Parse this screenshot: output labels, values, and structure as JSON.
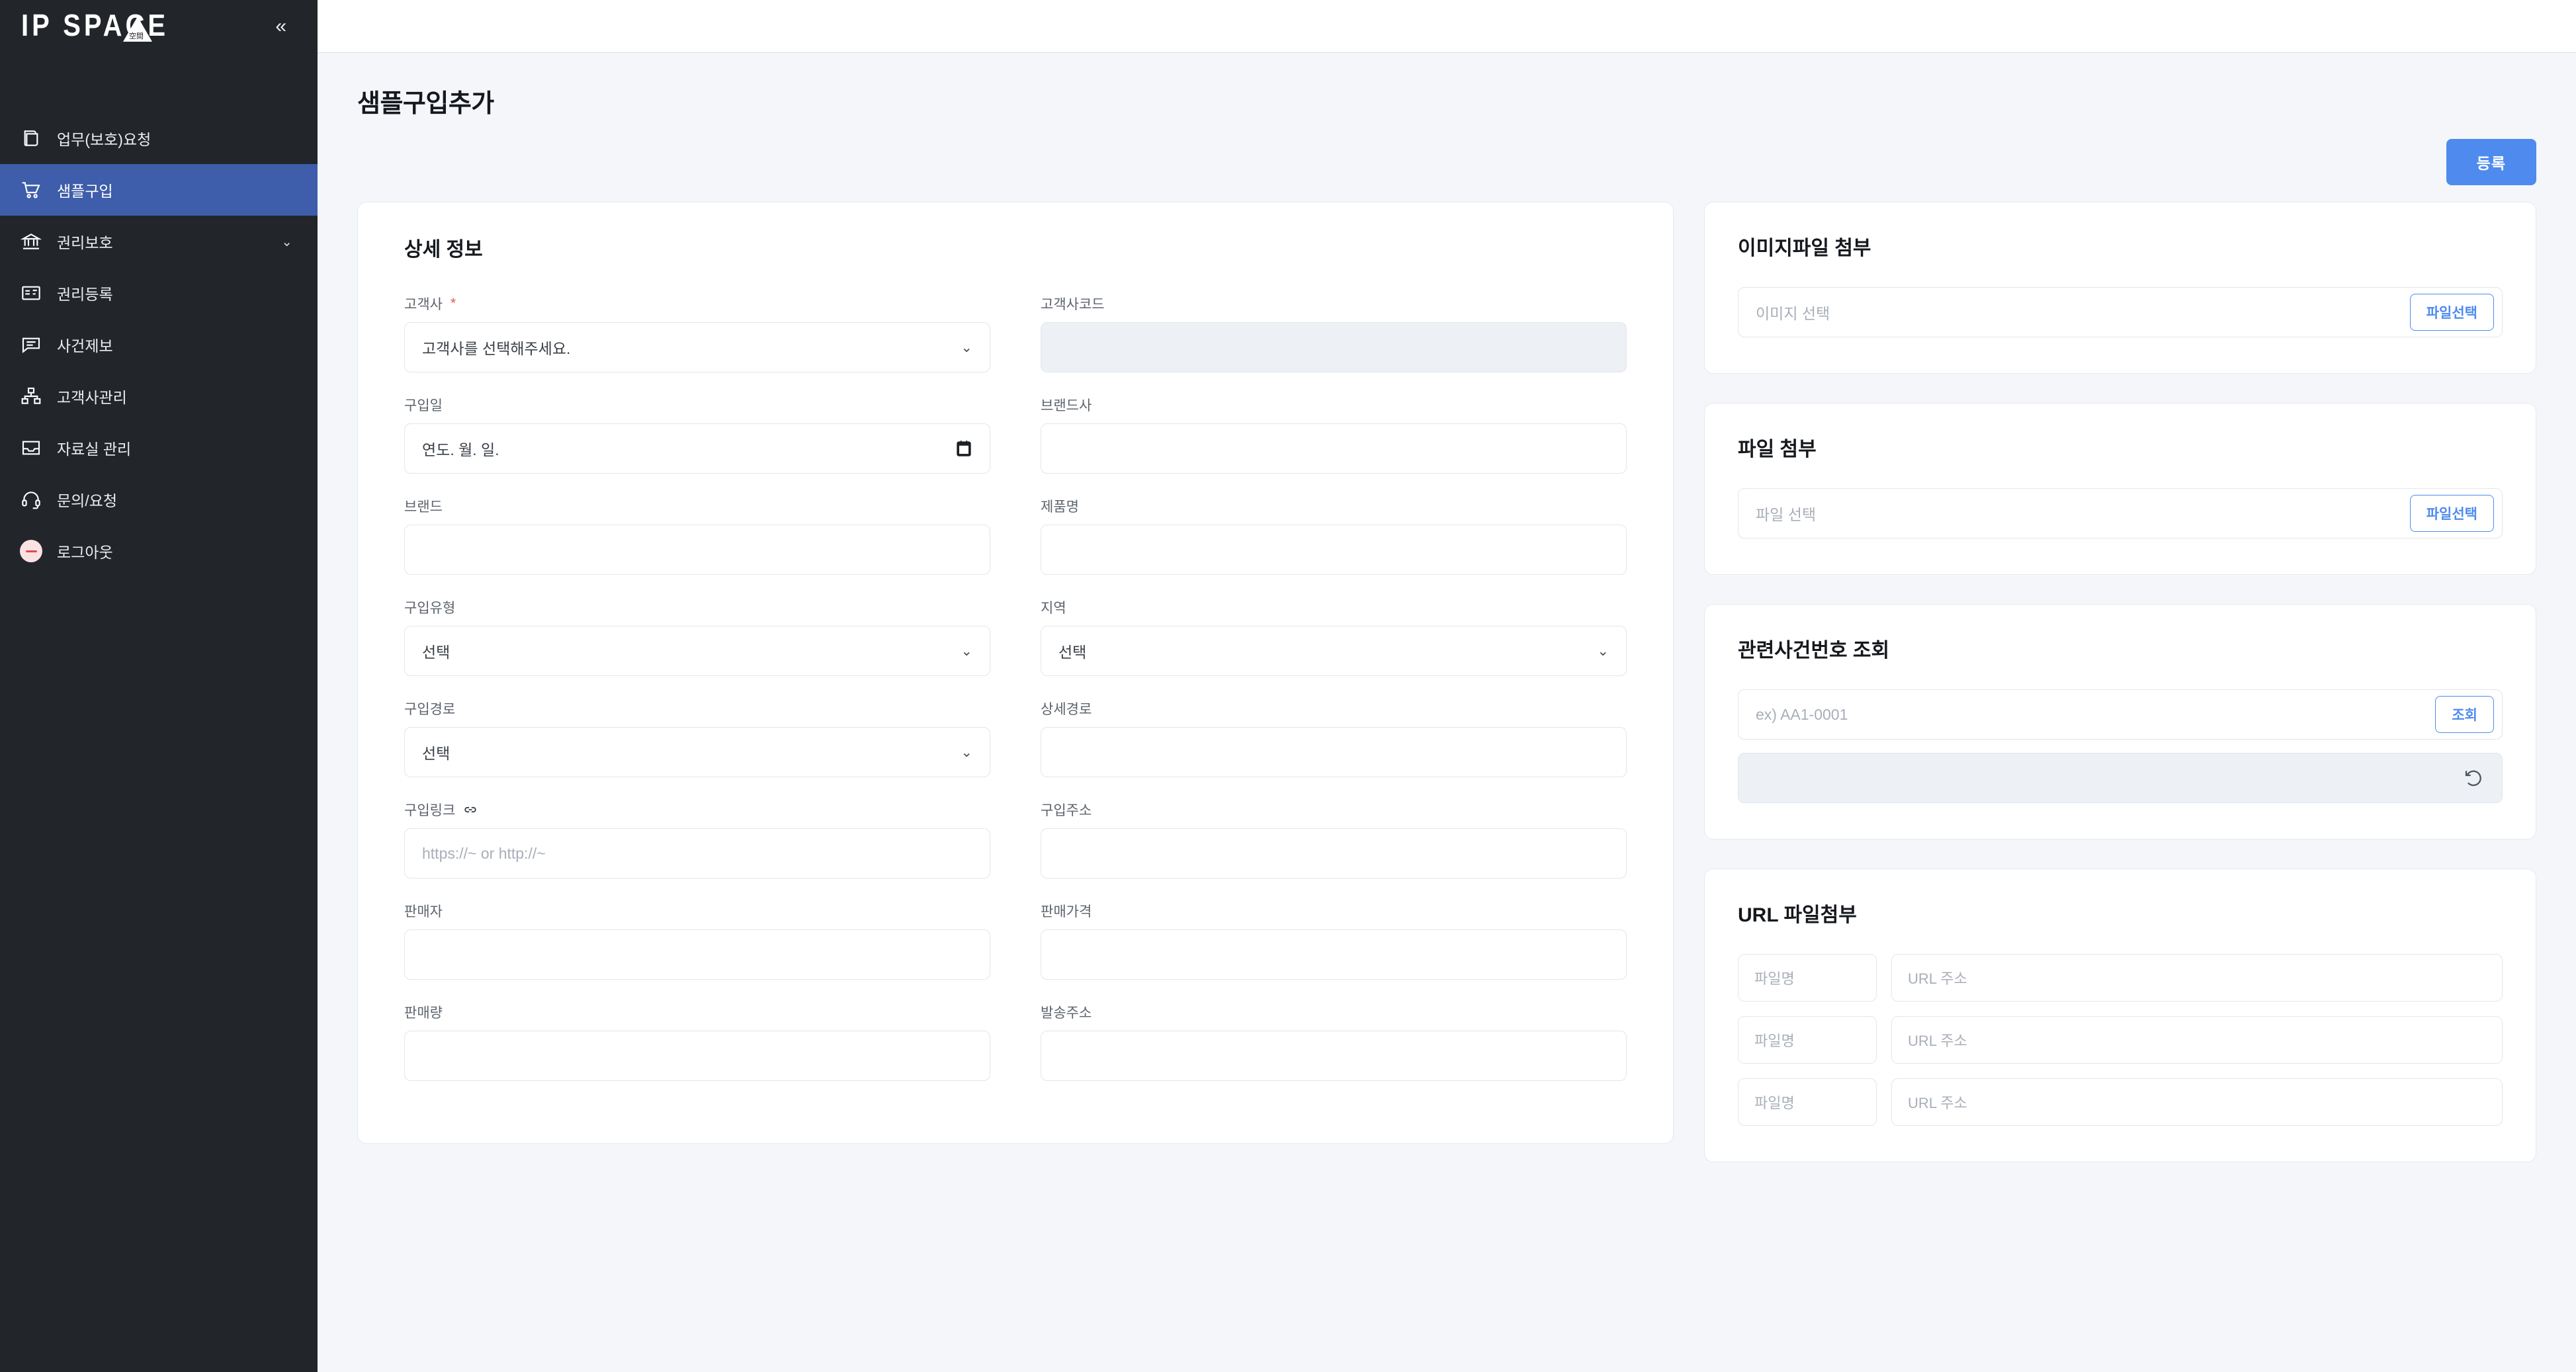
{
  "sidebar": {
    "logo": {
      "text_left": "IP",
      "text_right": "SPACE",
      "emblem_glyph": "空間"
    },
    "collapse_label": "«",
    "items": [
      {
        "label": "업무(보호)요청",
        "icon": "scroll-icon",
        "active": false,
        "chevron": ""
      },
      {
        "label": "샘플구입",
        "icon": "cart-icon",
        "active": true,
        "chevron": ""
      },
      {
        "label": "권리보호",
        "icon": "bank-icon",
        "active": false,
        "chevron": "⌄"
      },
      {
        "label": "권리등록",
        "icon": "certificate-icon",
        "active": false,
        "chevron": ""
      },
      {
        "label": "사건제보",
        "icon": "chat-icon",
        "active": false,
        "chevron": ""
      },
      {
        "label": "고객사관리",
        "icon": "org-chart-icon",
        "active": false,
        "chevron": ""
      },
      {
        "label": "자료실 관리",
        "icon": "inbox-icon",
        "active": false,
        "chevron": ""
      },
      {
        "label": "문의/요청",
        "icon": "headset-icon",
        "active": false,
        "chevron": ""
      },
      {
        "label": "로그아웃",
        "icon": "logout-icon",
        "active": false,
        "chevron": ""
      }
    ]
  },
  "header": {
    "page_title": "샘플구입추가",
    "submit_label": "등록"
  },
  "detail_card": {
    "title": "상세 정보",
    "fields": [
      {
        "label": "고객사",
        "required": true,
        "type": "select",
        "value": "고객사를 선택해주세요.",
        "placeholder_style": true
      },
      {
        "label": "고객사코드",
        "required": false,
        "type": "text",
        "value": "",
        "disabled": true
      },
      {
        "label": "구입일",
        "required": false,
        "type": "date",
        "value": "연도. 월. 일."
      },
      {
        "label": "브랜드사",
        "required": false,
        "type": "text",
        "value": ""
      },
      {
        "label": "브랜드",
        "required": false,
        "type": "text",
        "value": ""
      },
      {
        "label": "제품명",
        "required": false,
        "type": "text",
        "value": ""
      },
      {
        "label": "구입유형",
        "required": false,
        "type": "select",
        "value": "선택"
      },
      {
        "label": "지역",
        "required": false,
        "type": "select",
        "value": "선택"
      },
      {
        "label": "구입경로",
        "required": false,
        "type": "select",
        "value": "선택"
      },
      {
        "label": "상세경로",
        "required": false,
        "type": "text",
        "value": ""
      },
      {
        "label": "구입링크",
        "required": false,
        "type": "text",
        "value": "",
        "placeholder": "https://~ or http://~",
        "icon": "link-icon"
      },
      {
        "label": "구입주소",
        "required": false,
        "type": "text",
        "value": ""
      },
      {
        "label": "판매자",
        "required": false,
        "type": "text",
        "value": ""
      },
      {
        "label": "판매가격",
        "required": false,
        "type": "text",
        "value": ""
      },
      {
        "label": "판매량",
        "required": false,
        "type": "text",
        "value": ""
      },
      {
        "label": "발송주소",
        "required": false,
        "type": "text",
        "value": ""
      }
    ]
  },
  "image_attach_card": {
    "title": "이미지파일 첨부",
    "input_placeholder": "이미지 선택",
    "button_label": "파일선택"
  },
  "file_attach_card": {
    "title": "파일 첨부",
    "input_placeholder": "파일 선택",
    "button_label": "파일선택"
  },
  "case_lookup_card": {
    "title": "관련사건번호 조회",
    "input_placeholder": "ex) AA1-0001",
    "button_label": "조회",
    "result_value": "",
    "reset_icon": "undo-icon"
  },
  "url_attach_card": {
    "title": "URL 파일첨부",
    "rows": [
      {
        "name_placeholder": "파일명",
        "url_placeholder": "URL 주소"
      },
      {
        "name_placeholder": "파일명",
        "url_placeholder": "URL 주소"
      },
      {
        "name_placeholder": "파일명",
        "url_placeholder": "URL 주소"
      }
    ]
  },
  "colors": {
    "sidebar_bg": "#22262b",
    "sidebar_active": "#3e5daa",
    "primary_blue": "#4f8bee",
    "page_bg": "#f4f6fa",
    "required_red": "#e2574c"
  }
}
